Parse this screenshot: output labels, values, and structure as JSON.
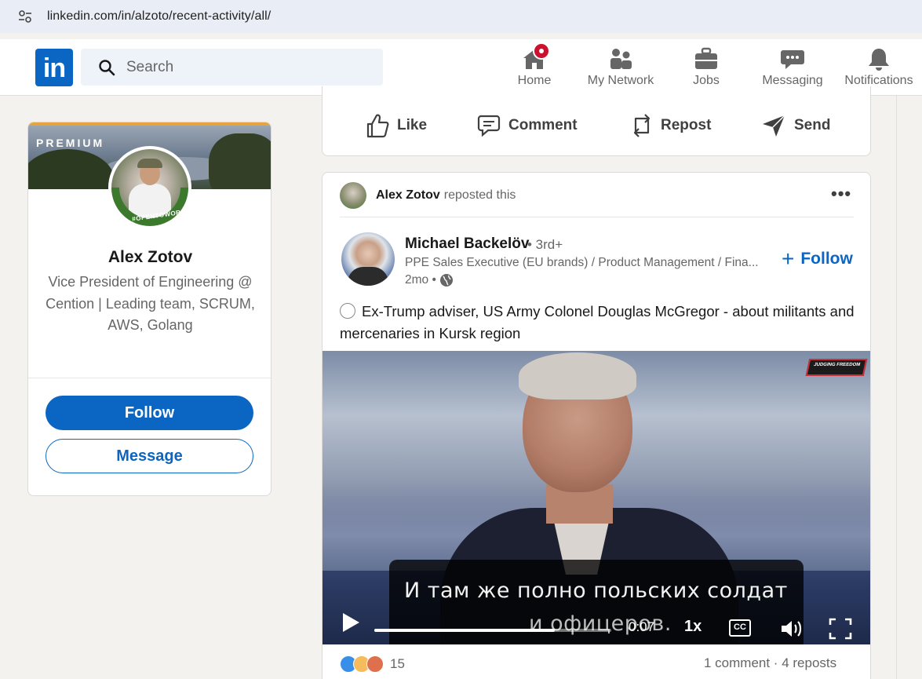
{
  "browser": {
    "url": "linkedin.com/in/alzoto/recent-activity/all/"
  },
  "header": {
    "logo": "in",
    "search_placeholder": "Search",
    "nav": [
      {
        "label": "Home",
        "icon": "home-icon",
        "has_badge": true
      },
      {
        "label": "My Network",
        "icon": "network-icon"
      },
      {
        "label": "Jobs",
        "icon": "briefcase-icon"
      },
      {
        "label": "Messaging",
        "icon": "messaging-icon"
      },
      {
        "label": "Notifications",
        "icon": "bell-icon"
      }
    ]
  },
  "profile": {
    "premium_label": "PREMIUM",
    "open_to_work": "#OPENTOWORK",
    "name": "Alex Zotov",
    "headline": "Vice President of Engineering @ Cention | Leading team, SCRUM, AWS, Golang",
    "follow_label": "Follow",
    "message_label": "Message"
  },
  "prev_post_actions": {
    "like": "Like",
    "comment": "Comment",
    "repost": "Repost",
    "send": "Send"
  },
  "post": {
    "reposter_name": "Alex Zotov",
    "reposted_text": "reposted this",
    "more": "•••",
    "author_name": "Michael Backelöv",
    "author_degree": "• 3rd+",
    "author_title": "PPE Sales Executive (EU brands) / Product Management / Fina...",
    "author_time": "2mo •",
    "follow_label": "Follow",
    "text": "Ex-Trump adviser, US Army Colonel Douglas McGregor - about militants and mercenaries in Kursk region",
    "video": {
      "subtitle_line1": "И там же полно польских солдат",
      "subtitle_line2": "и офицеров.",
      "channel_tag": "JUDGING FREEDOM",
      "time": "0:07",
      "speed": "1x",
      "cc_label": "CC",
      "progress": 0.76
    },
    "reaction_count": "15",
    "comments_reposts": "1 comment · 4 reposts"
  },
  "colors": {
    "brand": "#0a66c2",
    "badge": "#cb112d",
    "background": "#f4f2ee"
  }
}
